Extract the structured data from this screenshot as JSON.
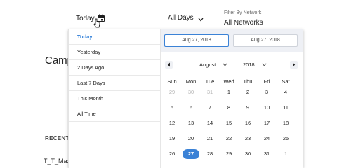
{
  "background": {
    "title": "Camp",
    "recent_label": "RECENTL",
    "row_text": "T_T_Max"
  },
  "header": {
    "date_trigger": {
      "label": "Today",
      "icon": "calendar-icon"
    },
    "days_select": {
      "label": "All Days",
      "icon": "chevron-down-icon"
    },
    "network_filter": {
      "label": "Filter By Network",
      "value": "All Networks"
    }
  },
  "date_picker": {
    "presets": [
      {
        "label": "Today",
        "active": true
      },
      {
        "label": "Yesterday",
        "active": false
      },
      {
        "label": "2 Days Ago",
        "active": false
      },
      {
        "label": "Last 7 Days",
        "active": false
      },
      {
        "label": "This Month",
        "active": false
      },
      {
        "label": "All Time",
        "active": false
      }
    ],
    "start_date": "Aug 27, 2018",
    "end_date": "Aug 27, 2018",
    "month": "August",
    "year": "2018",
    "weekdays": [
      "Sun",
      "Mon",
      "Tue",
      "Wed",
      "Thu",
      "Fri",
      "Sat"
    ],
    "weeks": [
      [
        {
          "d": "29",
          "m": true
        },
        {
          "d": "30",
          "m": true
        },
        {
          "d": "31",
          "m": true
        },
        {
          "d": "1"
        },
        {
          "d": "2"
        },
        {
          "d": "3"
        },
        {
          "d": "4"
        }
      ],
      [
        {
          "d": "5"
        },
        {
          "d": "6"
        },
        {
          "d": "7"
        },
        {
          "d": "8"
        },
        {
          "d": "9"
        },
        {
          "d": "10"
        },
        {
          "d": "11"
        }
      ],
      [
        {
          "d": "12"
        },
        {
          "d": "13"
        },
        {
          "d": "14"
        },
        {
          "d": "15"
        },
        {
          "d": "16"
        },
        {
          "d": "17"
        },
        {
          "d": "18"
        }
      ],
      [
        {
          "d": "19"
        },
        {
          "d": "20"
        },
        {
          "d": "21"
        },
        {
          "d": "22"
        },
        {
          "d": "23"
        },
        {
          "d": "24"
        },
        {
          "d": "25"
        }
      ],
      [
        {
          "d": "26"
        },
        {
          "d": "27",
          "s": true
        },
        {
          "d": "28"
        },
        {
          "d": "29"
        },
        {
          "d": "30"
        },
        {
          "d": "31"
        },
        {
          "d": "1",
          "m": true
        }
      ]
    ],
    "accent_color": "#3b82d6",
    "preset_active_color": "#2f7ed8"
  }
}
